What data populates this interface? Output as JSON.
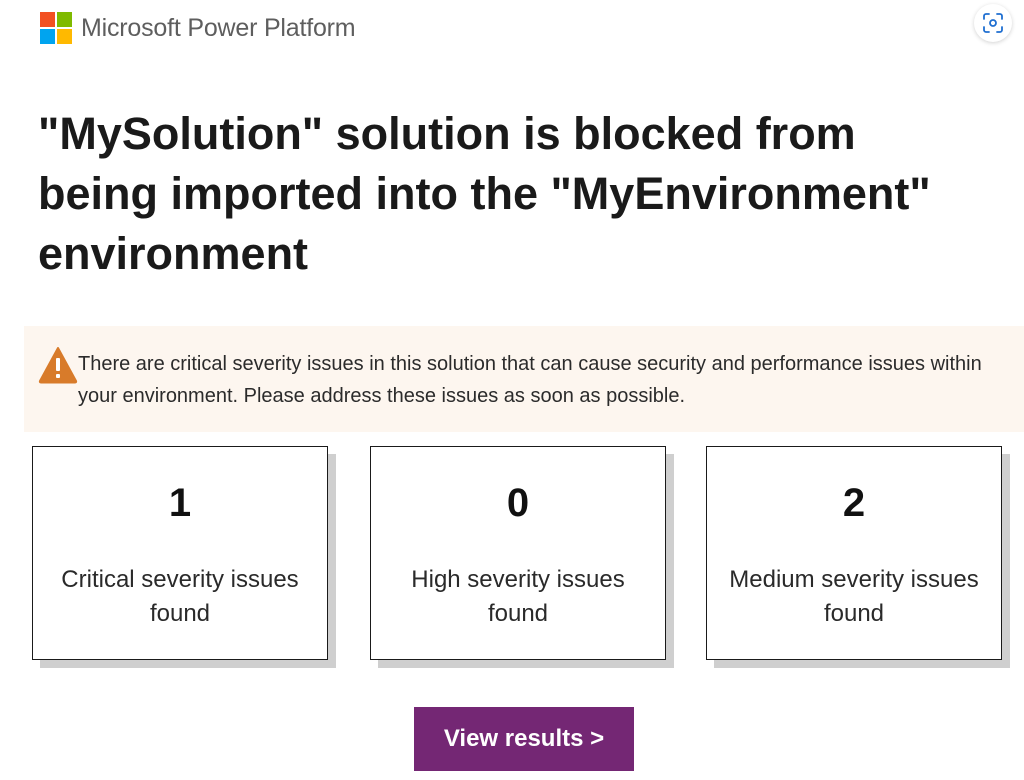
{
  "header": {
    "brand_name": "Microsoft Power Platform",
    "logo_colors": [
      "#f25022",
      "#7fba00",
      "#00a4ef",
      "#ffb900"
    ],
    "scan_icon": "visual-search-icon"
  },
  "title": "\"MySolution\" solution is blocked from being imported into the \"MyEnvironment\" environment",
  "banner": {
    "icon": "warning-icon",
    "icon_color": "#d87b2a",
    "text": "There are critical severity issues in this solution that can cause security and performance is­sues within your environment. Please address these issues as soon as possible."
  },
  "cards": [
    {
      "count": "1",
      "label": "Critical severity issues found"
    },
    {
      "count": "0",
      "label": "High severity issues found"
    },
    {
      "count": "2",
      "label": "Medium severity issues found"
    }
  ],
  "button": {
    "label": "View results >",
    "color": "#742774"
  }
}
